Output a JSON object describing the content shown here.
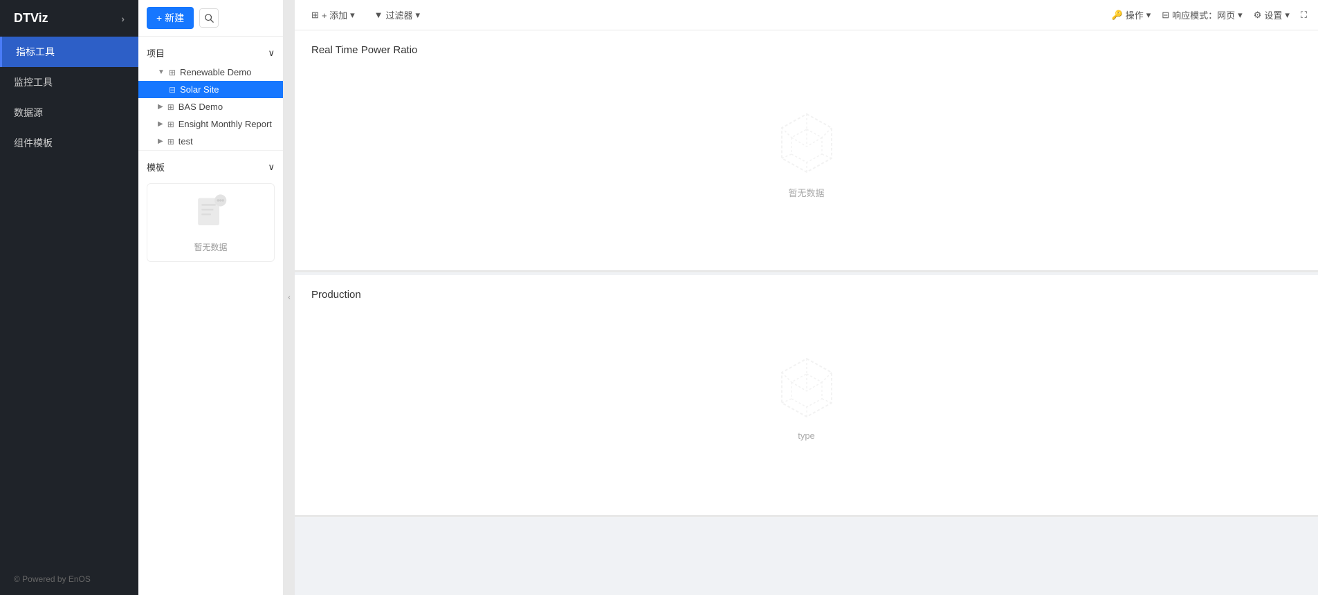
{
  "app": {
    "logo": "DTViz",
    "logo_chevron": "›",
    "powered_by": "© Powered by EnOS"
  },
  "sidebar": {
    "items": [
      {
        "label": "指标工具",
        "active": true
      },
      {
        "label": "监控工具",
        "active": false
      },
      {
        "label": "数据源",
        "active": false
      },
      {
        "label": "组件模板",
        "active": false
      }
    ]
  },
  "panel": {
    "new_button": "+ 新建",
    "project_section": "项目",
    "template_section": "模板",
    "tree": [
      {
        "label": "Renewable Demo",
        "expanded": true,
        "icon": "📁",
        "children": [
          {
            "label": "Solar Site",
            "icon": "📄",
            "active": true
          }
        ]
      },
      {
        "label": "BAS Demo",
        "icon": "📁",
        "expanded": false
      },
      {
        "label": "Ensight Monthly Report",
        "icon": "📁",
        "expanded": false
      },
      {
        "label": "test",
        "icon": "📁",
        "expanded": false
      }
    ],
    "template_empty_text": "暂无数据"
  },
  "toolbar": {
    "add_label": "+ 添加",
    "filter_label": "过滤器",
    "operation_label": "操作",
    "response_label": "响应模式：网页",
    "settings_label": "设置",
    "expand_label": "⛶"
  },
  "widgets": [
    {
      "title": "Real Time Power Ratio",
      "empty_text": "暂无数据",
      "has_data": false
    },
    {
      "title": "Production",
      "empty_text": "type",
      "has_data": false
    }
  ]
}
